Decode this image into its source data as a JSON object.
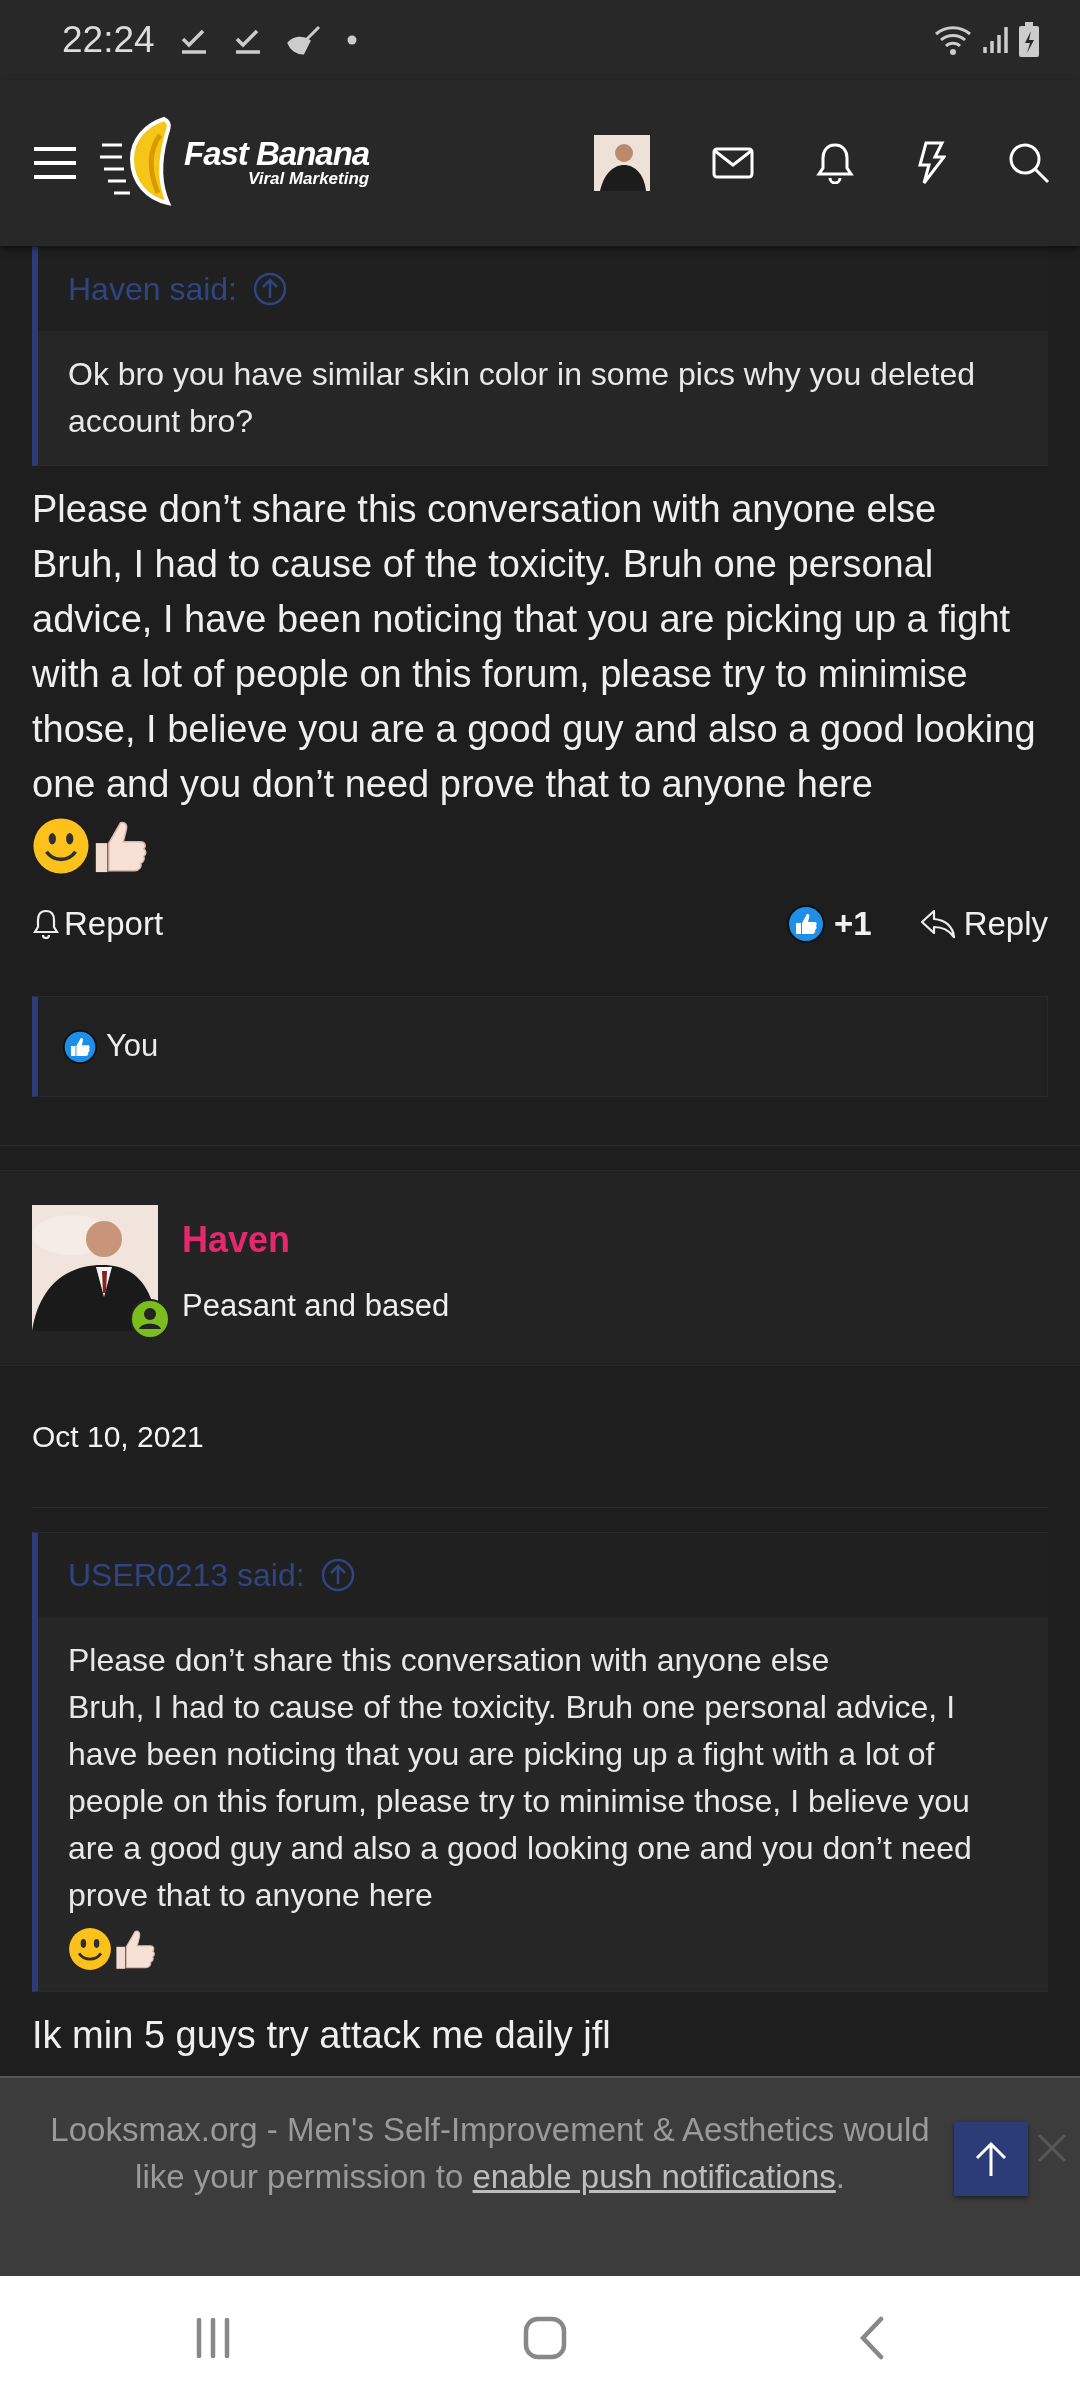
{
  "status_bar": {
    "time": "22:24"
  },
  "header": {
    "logo_title": "Fast Banana",
    "logo_subtitle": "Viral Marketing"
  },
  "posts": [
    {
      "kind": "continued",
      "quote": {
        "author_line": "Haven said:",
        "text": "Ok bro you have similar skin color in some pics why you deleted account bro?",
        "emojis": false
      },
      "body": "Please don’t share this conversation with anyone else\nBruh, I had to cause of the toxicity. Bruh one personal advice, I have been noticing that you are picking up a fight with a lot of people on this forum, please try to minimise those, I believe you are a good guy and also a good looking one and you don’t need prove that to anyone here",
      "body_emojis": true,
      "actions": {
        "report": "Report",
        "reaction_count": "+1",
        "reply": "Reply",
        "reacted": true
      },
      "reactions_text": "You"
    },
    {
      "kind": "full",
      "author": {
        "name": "Haven",
        "title": "Peasant and based",
        "online": true
      },
      "date": "Oct 10, 2021",
      "quote": {
        "author_line": "USER0213 said:",
        "text": "Please don’t share this conversation with anyone else\nBruh, I had to cause of the toxicity. Bruh one personal advice, I have been noticing that you are picking up a fight with a lot of people on this forum, please try to minimise those, I believe you are a good guy and also a good looking one and you don’t need prove that to anyone here",
        "emojis": true
      },
      "body": "Ik min 5 guys try attack me daily jfl",
      "body_emojis": false
    }
  ],
  "push_banner": {
    "text": "Looksmax.org - Men's Self-Improvement & Aesthetics would like your permission to",
    "link": "enable push notifications",
    "tail": "."
  }
}
